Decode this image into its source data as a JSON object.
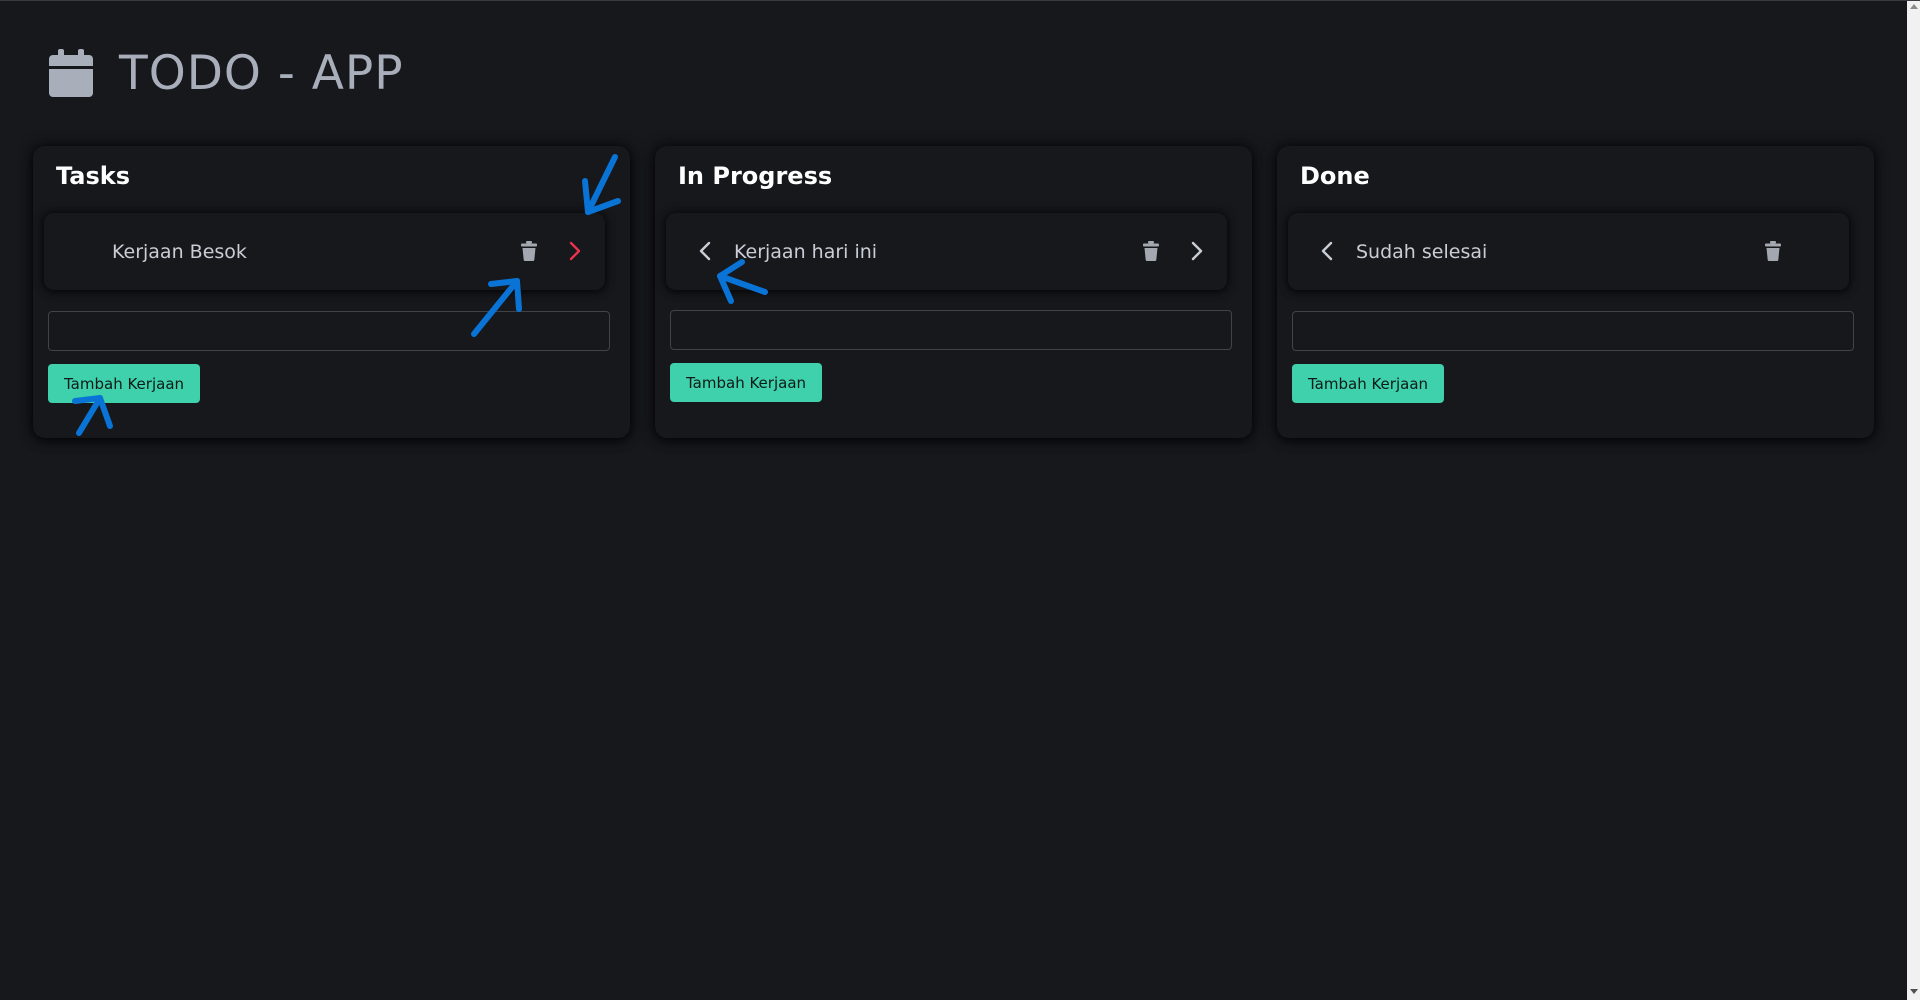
{
  "app": {
    "title": "TODO - APP",
    "icon": "calendar-icon"
  },
  "columns": [
    {
      "title": "Tasks",
      "tasks": [
        {
          "text": "Kerjaan Besok",
          "actions": [
            "trash-icon",
            "chevron-right-icon"
          ]
        }
      ],
      "input": {
        "value": "",
        "placeholder": ""
      },
      "add_button": "Tambah Kerjaan"
    },
    {
      "title": "In Progress",
      "tasks": [
        {
          "text": "Kerjaan hari ini",
          "actions": [
            "chevron-left-icon",
            "trash-icon",
            "chevron-right-icon"
          ]
        }
      ],
      "input": {
        "value": "",
        "placeholder": ""
      },
      "add_button": "Tambah Kerjaan"
    },
    {
      "title": "Done",
      "tasks": [
        {
          "text": "Sudah selesai",
          "actions": [
            "chevron-left-icon",
            "trash-icon"
          ]
        }
      ],
      "input": {
        "value": "",
        "placeholder": ""
      },
      "add_button": "Tambah Kerjaan"
    }
  ],
  "colors": {
    "background": "#17181c",
    "accent": "#3fd1ac",
    "next_highlight": "#e8334a",
    "annotation": "#0a73d6"
  },
  "annotations": [
    "arrow-icon",
    "arrow-icon",
    "arrow-icon",
    "arrow-icon"
  ]
}
